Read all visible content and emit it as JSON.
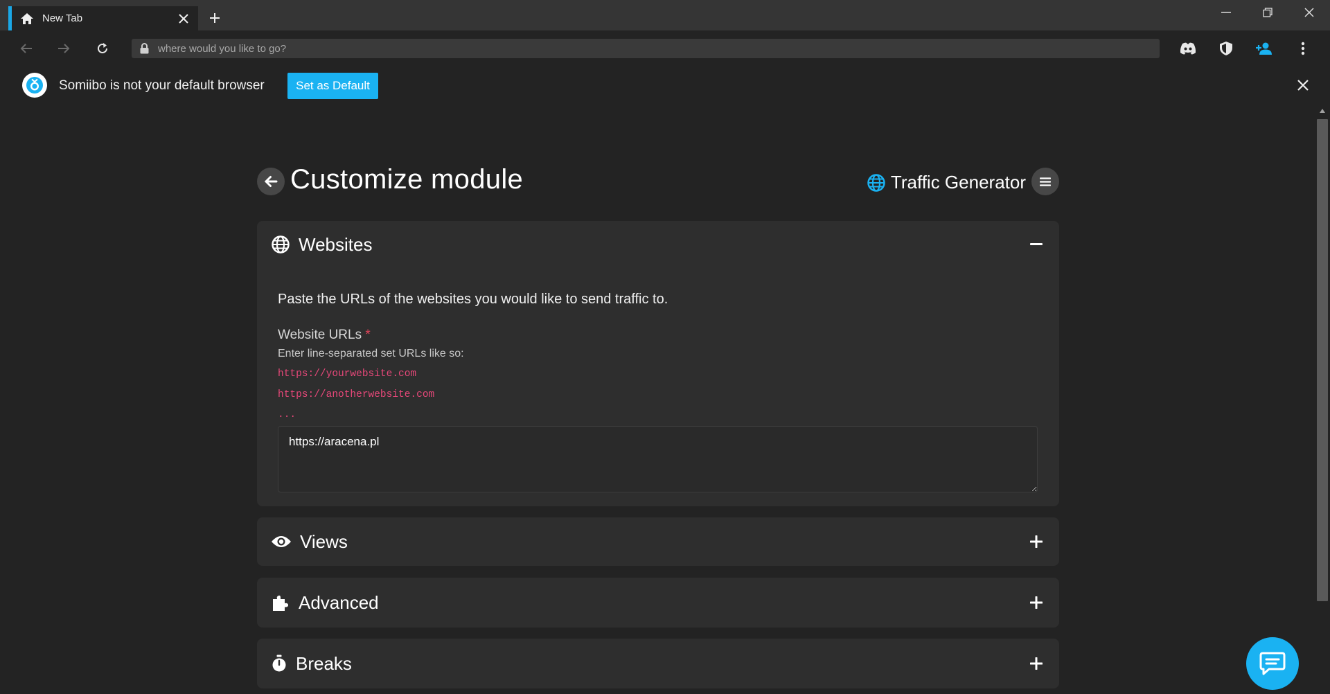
{
  "browser": {
    "tab_title": "New Tab",
    "address_placeholder": "where would you like to go?"
  },
  "infobar": {
    "message": "Somiibo is not your default browser",
    "button_label": "Set as Default"
  },
  "page": {
    "title": "Customize module",
    "module_name": "Traffic Generator"
  },
  "sections": {
    "websites": {
      "title": "Websites",
      "description": "Paste the URLs of the websites you would like to send traffic to.",
      "field_label": "Website URLs",
      "required_mark": "*",
      "help_text": "Enter line-separated set URLs like so:",
      "example_1": "https://yourwebsite.com",
      "example_2": "https://anotherwebsite.com",
      "example_3": "...",
      "value": "https://aracena.pl"
    },
    "views": {
      "title": "Views"
    },
    "advanced": {
      "title": "Advanced"
    },
    "breaks": {
      "title": "Breaks"
    }
  },
  "colors": {
    "accent": "#1ab2f2",
    "code": "#e8487a",
    "required": "#e0445a"
  }
}
